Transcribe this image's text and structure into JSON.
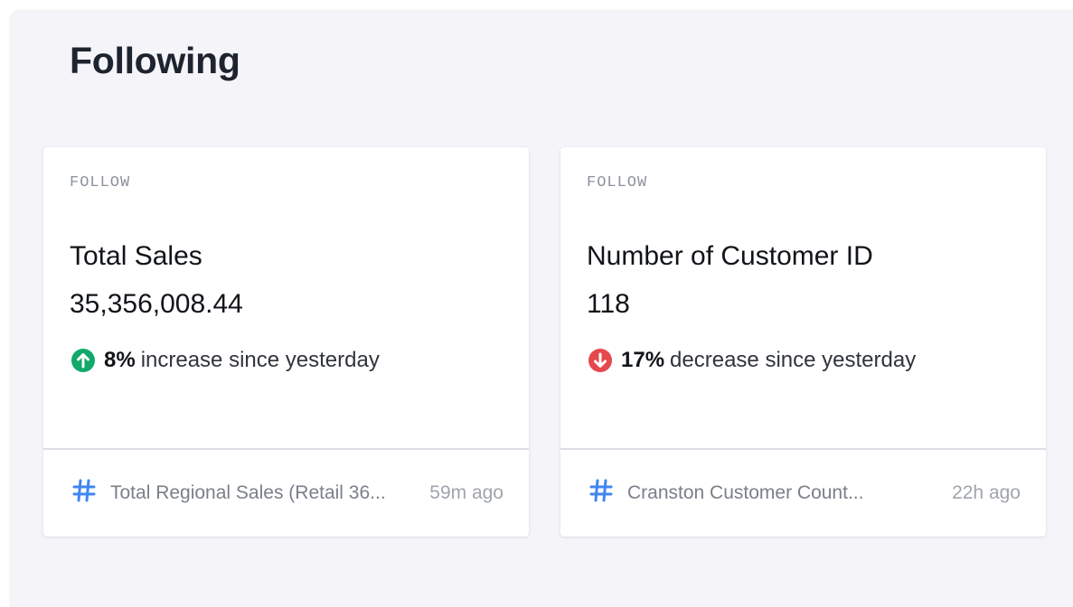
{
  "page": {
    "title": "Following"
  },
  "cards": [
    {
      "eyebrow": "FOLLOW",
      "metric_name": "Total Sales",
      "metric_value": "35,356,008.44",
      "change": {
        "direction": "up",
        "icon": "arrow-up-circle-icon",
        "color": "#12a96a",
        "percent": "8%",
        "text": "increase since yesterday"
      },
      "source": {
        "icon": "hash-icon",
        "name": "Total Regional Sales (Retail 36...",
        "ago": "59m ago"
      }
    },
    {
      "eyebrow": "FOLLOW",
      "metric_name": "Number of Customer ID",
      "metric_value": "118",
      "change": {
        "direction": "down",
        "icon": "arrow-down-circle-icon",
        "color": "#e5484d",
        "percent": "17%",
        "text": "decrease since yesterday"
      },
      "source": {
        "icon": "hash-icon",
        "name": "Cranston Customer Count...",
        "ago": "22h ago"
      }
    }
  ],
  "colors": {
    "accent_blue": "#3f86f0",
    "panel_bg": "#f4f4f9",
    "title": "#1d232f"
  }
}
